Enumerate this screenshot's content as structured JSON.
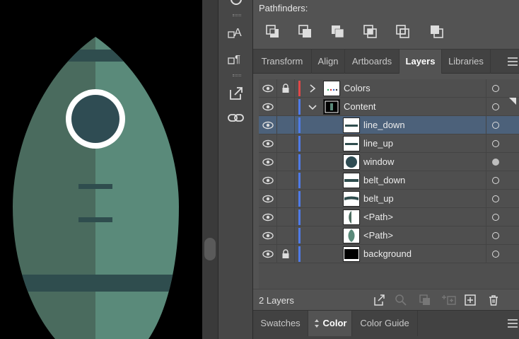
{
  "pathfinders": {
    "title": "Pathfinders:"
  },
  "tabs": [
    {
      "label": "Transform"
    },
    {
      "label": "Align"
    },
    {
      "label": "Artboards"
    },
    {
      "label": "Layers",
      "active": true
    },
    {
      "label": "Libraries"
    }
  ],
  "layers": [
    {
      "name": "Colors",
      "locked": true,
      "expand": "collapsed",
      "color": "#e04848",
      "thumb": "colors"
    },
    {
      "name": "Content",
      "locked": false,
      "expand": "expanded",
      "color": "#4f7be8",
      "thumb": "content"
    }
  ],
  "sublayers": [
    {
      "name": "line_down",
      "selected": true,
      "thumb": "line-down"
    },
    {
      "name": "line_up",
      "thumb": "line-up"
    },
    {
      "name": "window",
      "thumb": "window",
      "target_filled": true
    },
    {
      "name": "belt_down",
      "thumb": "belt-down"
    },
    {
      "name": "belt_up",
      "thumb": "belt-up"
    },
    {
      "name": "<Path>",
      "thumb": "path-dark"
    },
    {
      "name": "<Path>",
      "thumb": "path-light"
    },
    {
      "name": "background",
      "locked": true,
      "thumb": "background"
    }
  ],
  "footer": {
    "layer_count": "2 Layers"
  },
  "bottom_tabs": [
    {
      "label": "Swatches"
    },
    {
      "label": "Color",
      "active": true,
      "icon": "up-down-arrows-icon"
    },
    {
      "label": "Color Guide"
    }
  ],
  "colors": {
    "rocket_dark": "#4a6b5e",
    "rocket_light": "#5a8a7a",
    "belt": "#2f4d4e",
    "window": "#2f4c53",
    "selection": "#4c617a",
    "layer_blue": "#4f7be8",
    "layer_red": "#e04848"
  }
}
